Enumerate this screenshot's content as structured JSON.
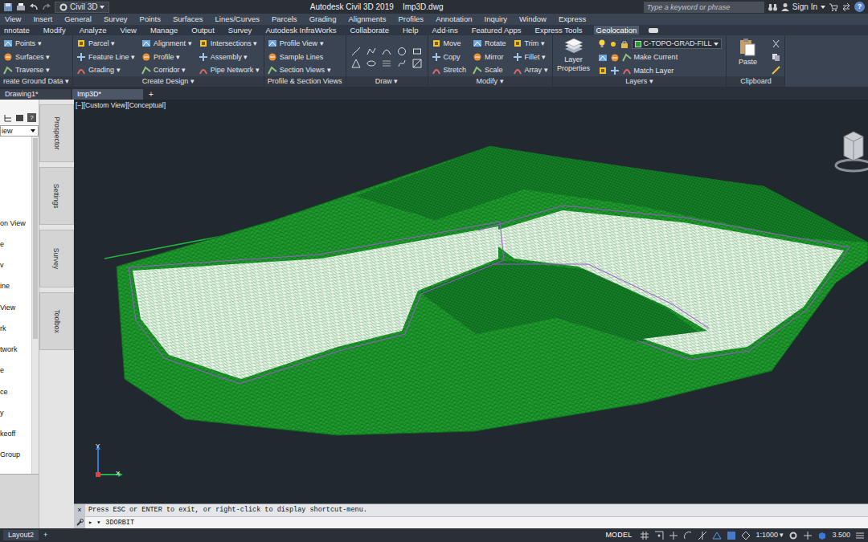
{
  "title_bar": {
    "workspace": "Civil 3D",
    "title": "Autodesk Civil 3D 2019    Imp3D.dwg",
    "search_placeholder": "Type a keyword or phrase",
    "sign_in": "Sign In",
    "help": "?"
  },
  "menu_bar": [
    "View",
    "Insert",
    "General",
    "Survey",
    "Points",
    "Surfaces",
    "Lines/Curves",
    "Parcels",
    "Grading",
    "Alignments",
    "Profiles",
    "Annotation",
    "Inquiry",
    "Window",
    "Express"
  ],
  "ribbon_tabs": [
    {
      "label": "nnotate",
      "selected": false
    },
    {
      "label": "Modify",
      "selected": false
    },
    {
      "label": "Analyze",
      "selected": false
    },
    {
      "label": "View",
      "selected": false
    },
    {
      "label": "Manage",
      "selected": false
    },
    {
      "label": "Output",
      "selected": false
    },
    {
      "label": "Survey",
      "selected": false
    },
    {
      "label": "Autodesk InfraWorks",
      "selected": false
    },
    {
      "label": "Collaborate",
      "selected": false
    },
    {
      "label": "Help",
      "selected": false
    },
    {
      "label": "Add-ins",
      "selected": false
    },
    {
      "label": "Featured Apps",
      "selected": false
    },
    {
      "label": "Express Tools",
      "selected": false
    },
    {
      "label": "Geolocation",
      "selected": true
    }
  ],
  "ribbon_panels": [
    {
      "kind": "tools",
      "title": "reate Ground Data ▾",
      "columns": [
        [
          "Points ▾",
          "Surfaces ▾",
          "Traverse ▾"
        ]
      ]
    },
    {
      "kind": "tools",
      "title": "Create Design ▾",
      "columns": [
        [
          "Parcel ▾",
          "Feature Line ▾",
          "Grading ▾"
        ],
        [
          "Alignment ▾",
          "Profile ▾",
          "Corridor ▾"
        ],
        [
          "Intersections ▾",
          "Assembly ▾",
          "Pipe Network ▾"
        ]
      ]
    },
    {
      "kind": "tools",
      "title": "Profile & Section Views",
      "columns": [
        [
          "Profile View ▾",
          "Sample Lines",
          "Section Views ▾"
        ]
      ]
    },
    {
      "kind": "draw",
      "title": "Draw ▾"
    },
    {
      "kind": "tools",
      "title": "Modify ▾",
      "columns": [
        [
          "Move",
          "Copy",
          "Stretch"
        ],
        [
          "Rotate",
          "Mirror",
          "Scale"
        ],
        [
          "Trim ▾",
          "Fillet ▾",
          "Array ▾"
        ]
      ]
    },
    {
      "kind": "layers",
      "title": "Layers ▾",
      "big": "Layer Properties",
      "layer": "C-TOPO-GRAD-FILL",
      "columns": [
        [
          "Make Current",
          "Match Layer"
        ]
      ]
    },
    {
      "kind": "clipboard",
      "title": "Clipboard",
      "big": "Paste"
    }
  ],
  "file_tabs": [
    {
      "label": "Drawing1*",
      "selected": false
    },
    {
      "label": "Imp3D*",
      "selected": true
    }
  ],
  "new_tab": "+",
  "toolspace": {
    "view_select": "iew",
    "help": "?",
    "side_tabs": [
      "Prospector",
      "Settings",
      "Survey",
      "Toolbox"
    ],
    "items": [
      "on View",
      "e",
      "v",
      "ine",
      "View",
      "rk",
      "twork",
      "e",
      "ce",
      "y",
      "keoff",
      "Group"
    ]
  },
  "viewport": {
    "label": "[−][Custom View][Conceptual]",
    "ucs": {
      "x": "X",
      "y": "Y"
    }
  },
  "command_line": {
    "close": "×",
    "history": "Press ESC or ENTER to exit, or right-click to display shortcut-menu.",
    "prompt": "▸ ▾",
    "input": "3DORBIT"
  },
  "status_bar": {
    "layout_tab": "Layout2",
    "new_layout": "+",
    "model": "MODEL",
    "scale": "1:1000 ▾",
    "value": "3.500"
  }
}
